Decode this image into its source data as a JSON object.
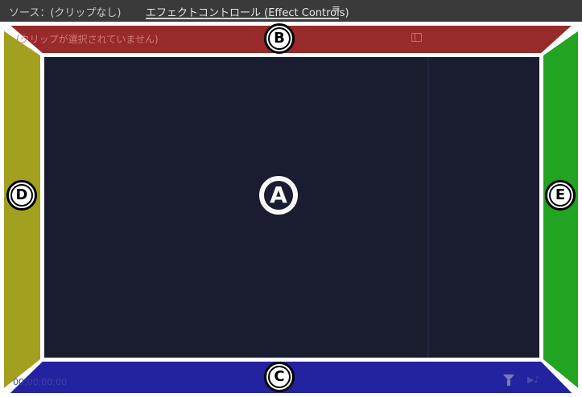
{
  "tabs": {
    "source_label": "ソース：(クリップなし)",
    "effect_controls_label": "エフェクトコントロール (Effect Controls)",
    "menu_glyph": "≡"
  },
  "panel": {
    "no_clip_message": "(クリップが選択されていません)",
    "timecode": "00;00;00;00"
  },
  "regions": {
    "a": "A",
    "b": "B",
    "c": "C",
    "d": "D",
    "e": "E"
  },
  "colors": {
    "tabbar": "#3a3a3a",
    "top_region": "#972a2a",
    "bottom_region": "#2323a0",
    "left_region": "#a3a020",
    "right_region": "#22a322",
    "center_region": "#1a1c30",
    "frame_lines": "#ffffff"
  },
  "icons": {
    "panel_toggle": "panel-icon",
    "filter": "filter-icon",
    "play_audio": "play-audio-icon"
  }
}
